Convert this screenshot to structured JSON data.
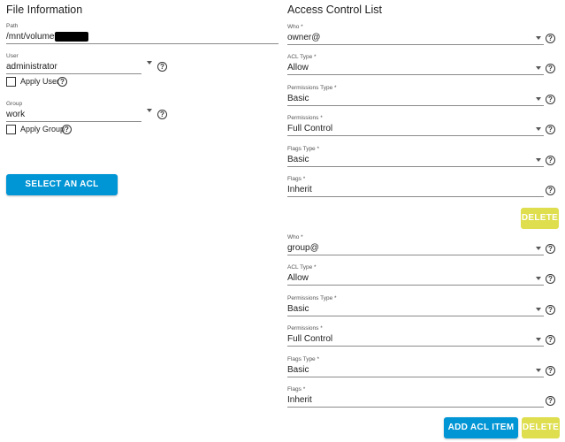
{
  "file_info": {
    "title": "File Information",
    "path": {
      "label": "Path",
      "value": "/mnt/volume0/"
    },
    "user": {
      "label": "User",
      "value": "administrator",
      "apply_label": "Apply User"
    },
    "group": {
      "label": "Group",
      "value": "work",
      "apply_label": "Apply Group"
    },
    "preset_button": "SELECT AN ACL PRESET"
  },
  "acl": {
    "title": "Access Control List",
    "entries": [
      {
        "who": {
          "label": "Who *",
          "value": "owner@"
        },
        "acl_type": {
          "label": "ACL Type *",
          "value": "Allow"
        },
        "permissions_type": {
          "label": "Permissions Type *",
          "value": "Basic"
        },
        "permissions": {
          "label": "Permissions *",
          "value": "Full Control"
        },
        "flags_type": {
          "label": "Flags Type *",
          "value": "Basic"
        },
        "flags": {
          "label": "Flags *",
          "value": "Inherit"
        },
        "delete_label": "DELETE"
      },
      {
        "who": {
          "label": "Who *",
          "value": "group@"
        },
        "acl_type": {
          "label": "ACL Type *",
          "value": "Allow"
        },
        "permissions_type": {
          "label": "Permissions Type *",
          "value": "Basic"
        },
        "permissions": {
          "label": "Permissions *",
          "value": "Full Control"
        },
        "flags_type": {
          "label": "Flags Type *",
          "value": "Basic"
        },
        "flags": {
          "label": "Flags *",
          "value": "Inherit"
        },
        "delete_label": "DELETE"
      }
    ],
    "add_button": "ADD ACL ITEM"
  },
  "icons": {
    "help": "help-circle-icon",
    "dropdown": "chevron-down-icon",
    "checkbox": "checkbox-unchecked-icon"
  },
  "colors": {
    "primary": "#0095d5",
    "warning": "#dede4e"
  }
}
